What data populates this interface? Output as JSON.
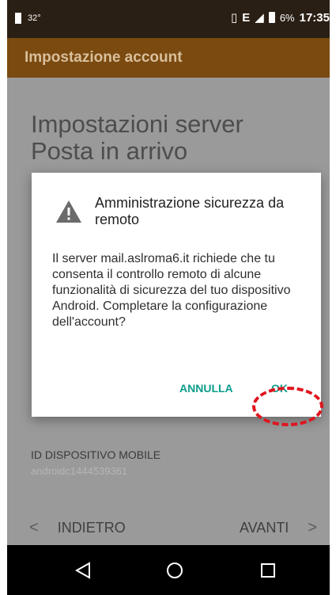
{
  "status_bar": {
    "temperature": "32°",
    "signal_label": "E",
    "battery": "6%",
    "time": "17:35"
  },
  "app_bar": {
    "title": "Impostazione account"
  },
  "screen": {
    "heading": "Impostazioni server Posta in arrivo",
    "device_id_label": "ID DISPOSITIVO MOBILE",
    "device_id_value": "androidc1444539361"
  },
  "navigation": {
    "back_label": "INDIETRO",
    "next_label": "AVANTI",
    "back_icon": "chevron-left-icon",
    "next_icon": "chevron-right-icon"
  },
  "dialog": {
    "icon": "warning-icon",
    "title": "Amministrazione sicurezza da remoto",
    "message": "Il server mail.aslroma6.it richiede che tu consenta il controllo remoto di alcune funzionalità di sicurezza del tuo dispositivo Android. Completare la configurazione dell'account?",
    "cancel_label": "ANNULLA",
    "ok_label": "OK"
  },
  "system_nav": {
    "back_icon": "triangle-back-icon",
    "home_icon": "circle-home-icon",
    "recents_icon": "square-recents-icon"
  },
  "colors": {
    "app_bar": "#7a4a10",
    "status_bar": "#2a1f14",
    "dialog_button": "#0c9c8c",
    "highlight": "#e0141e"
  }
}
